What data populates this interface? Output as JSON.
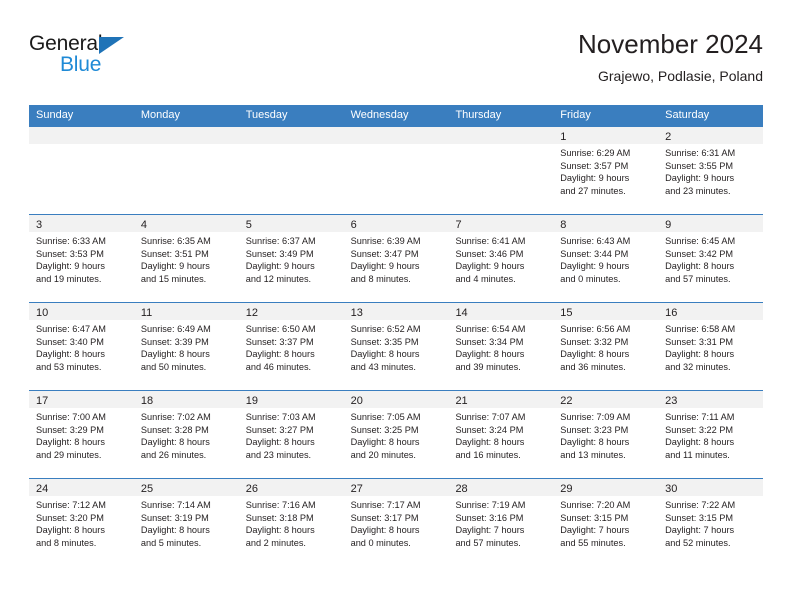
{
  "brand": {
    "name_part1": "General",
    "name_part2": "Blue",
    "color_dark": "#1a1a1a",
    "color_blue": "#1f8ad6"
  },
  "header": {
    "title": "November 2024",
    "location": "Grajewo, Podlasie, Poland",
    "accent_color": "#3a7ebf"
  },
  "weekdays": [
    "Sunday",
    "Monday",
    "Tuesday",
    "Wednesday",
    "Thursday",
    "Friday",
    "Saturday"
  ],
  "weeks": [
    [
      {
        "day": "",
        "sunrise": "",
        "sunset": "",
        "daylight1": "",
        "daylight2": ""
      },
      {
        "day": "",
        "sunrise": "",
        "sunset": "",
        "daylight1": "",
        "daylight2": ""
      },
      {
        "day": "",
        "sunrise": "",
        "sunset": "",
        "daylight1": "",
        "daylight2": ""
      },
      {
        "day": "",
        "sunrise": "",
        "sunset": "",
        "daylight1": "",
        "daylight2": ""
      },
      {
        "day": "",
        "sunrise": "",
        "sunset": "",
        "daylight1": "",
        "daylight2": ""
      },
      {
        "day": "1",
        "sunrise": "Sunrise: 6:29 AM",
        "sunset": "Sunset: 3:57 PM",
        "daylight1": "Daylight: 9 hours",
        "daylight2": "and 27 minutes."
      },
      {
        "day": "2",
        "sunrise": "Sunrise: 6:31 AM",
        "sunset": "Sunset: 3:55 PM",
        "daylight1": "Daylight: 9 hours",
        "daylight2": "and 23 minutes."
      }
    ],
    [
      {
        "day": "3",
        "sunrise": "Sunrise: 6:33 AM",
        "sunset": "Sunset: 3:53 PM",
        "daylight1": "Daylight: 9 hours",
        "daylight2": "and 19 minutes."
      },
      {
        "day": "4",
        "sunrise": "Sunrise: 6:35 AM",
        "sunset": "Sunset: 3:51 PM",
        "daylight1": "Daylight: 9 hours",
        "daylight2": "and 15 minutes."
      },
      {
        "day": "5",
        "sunrise": "Sunrise: 6:37 AM",
        "sunset": "Sunset: 3:49 PM",
        "daylight1": "Daylight: 9 hours",
        "daylight2": "and 12 minutes."
      },
      {
        "day": "6",
        "sunrise": "Sunrise: 6:39 AM",
        "sunset": "Sunset: 3:47 PM",
        "daylight1": "Daylight: 9 hours",
        "daylight2": "and 8 minutes."
      },
      {
        "day": "7",
        "sunrise": "Sunrise: 6:41 AM",
        "sunset": "Sunset: 3:46 PM",
        "daylight1": "Daylight: 9 hours",
        "daylight2": "and 4 minutes."
      },
      {
        "day": "8",
        "sunrise": "Sunrise: 6:43 AM",
        "sunset": "Sunset: 3:44 PM",
        "daylight1": "Daylight: 9 hours",
        "daylight2": "and 0 minutes."
      },
      {
        "day": "9",
        "sunrise": "Sunrise: 6:45 AM",
        "sunset": "Sunset: 3:42 PM",
        "daylight1": "Daylight: 8 hours",
        "daylight2": "and 57 minutes."
      }
    ],
    [
      {
        "day": "10",
        "sunrise": "Sunrise: 6:47 AM",
        "sunset": "Sunset: 3:40 PM",
        "daylight1": "Daylight: 8 hours",
        "daylight2": "and 53 minutes."
      },
      {
        "day": "11",
        "sunrise": "Sunrise: 6:49 AM",
        "sunset": "Sunset: 3:39 PM",
        "daylight1": "Daylight: 8 hours",
        "daylight2": "and 50 minutes."
      },
      {
        "day": "12",
        "sunrise": "Sunrise: 6:50 AM",
        "sunset": "Sunset: 3:37 PM",
        "daylight1": "Daylight: 8 hours",
        "daylight2": "and 46 minutes."
      },
      {
        "day": "13",
        "sunrise": "Sunrise: 6:52 AM",
        "sunset": "Sunset: 3:35 PM",
        "daylight1": "Daylight: 8 hours",
        "daylight2": "and 43 minutes."
      },
      {
        "day": "14",
        "sunrise": "Sunrise: 6:54 AM",
        "sunset": "Sunset: 3:34 PM",
        "daylight1": "Daylight: 8 hours",
        "daylight2": "and 39 minutes."
      },
      {
        "day": "15",
        "sunrise": "Sunrise: 6:56 AM",
        "sunset": "Sunset: 3:32 PM",
        "daylight1": "Daylight: 8 hours",
        "daylight2": "and 36 minutes."
      },
      {
        "day": "16",
        "sunrise": "Sunrise: 6:58 AM",
        "sunset": "Sunset: 3:31 PM",
        "daylight1": "Daylight: 8 hours",
        "daylight2": "and 32 minutes."
      }
    ],
    [
      {
        "day": "17",
        "sunrise": "Sunrise: 7:00 AM",
        "sunset": "Sunset: 3:29 PM",
        "daylight1": "Daylight: 8 hours",
        "daylight2": "and 29 minutes."
      },
      {
        "day": "18",
        "sunrise": "Sunrise: 7:02 AM",
        "sunset": "Sunset: 3:28 PM",
        "daylight1": "Daylight: 8 hours",
        "daylight2": "and 26 minutes."
      },
      {
        "day": "19",
        "sunrise": "Sunrise: 7:03 AM",
        "sunset": "Sunset: 3:27 PM",
        "daylight1": "Daylight: 8 hours",
        "daylight2": "and 23 minutes."
      },
      {
        "day": "20",
        "sunrise": "Sunrise: 7:05 AM",
        "sunset": "Sunset: 3:25 PM",
        "daylight1": "Daylight: 8 hours",
        "daylight2": "and 20 minutes."
      },
      {
        "day": "21",
        "sunrise": "Sunrise: 7:07 AM",
        "sunset": "Sunset: 3:24 PM",
        "daylight1": "Daylight: 8 hours",
        "daylight2": "and 16 minutes."
      },
      {
        "day": "22",
        "sunrise": "Sunrise: 7:09 AM",
        "sunset": "Sunset: 3:23 PM",
        "daylight1": "Daylight: 8 hours",
        "daylight2": "and 13 minutes."
      },
      {
        "day": "23",
        "sunrise": "Sunrise: 7:11 AM",
        "sunset": "Sunset: 3:22 PM",
        "daylight1": "Daylight: 8 hours",
        "daylight2": "and 11 minutes."
      }
    ],
    [
      {
        "day": "24",
        "sunrise": "Sunrise: 7:12 AM",
        "sunset": "Sunset: 3:20 PM",
        "daylight1": "Daylight: 8 hours",
        "daylight2": "and 8 minutes."
      },
      {
        "day": "25",
        "sunrise": "Sunrise: 7:14 AM",
        "sunset": "Sunset: 3:19 PM",
        "daylight1": "Daylight: 8 hours",
        "daylight2": "and 5 minutes."
      },
      {
        "day": "26",
        "sunrise": "Sunrise: 7:16 AM",
        "sunset": "Sunset: 3:18 PM",
        "daylight1": "Daylight: 8 hours",
        "daylight2": "and 2 minutes."
      },
      {
        "day": "27",
        "sunrise": "Sunrise: 7:17 AM",
        "sunset": "Sunset: 3:17 PM",
        "daylight1": "Daylight: 8 hours",
        "daylight2": "and 0 minutes."
      },
      {
        "day": "28",
        "sunrise": "Sunrise: 7:19 AM",
        "sunset": "Sunset: 3:16 PM",
        "daylight1": "Daylight: 7 hours",
        "daylight2": "and 57 minutes."
      },
      {
        "day": "29",
        "sunrise": "Sunrise: 7:20 AM",
        "sunset": "Sunset: 3:15 PM",
        "daylight1": "Daylight: 7 hours",
        "daylight2": "and 55 minutes."
      },
      {
        "day": "30",
        "sunrise": "Sunrise: 7:22 AM",
        "sunset": "Sunset: 3:15 PM",
        "daylight1": "Daylight: 7 hours",
        "daylight2": "and 52 minutes."
      }
    ]
  ]
}
